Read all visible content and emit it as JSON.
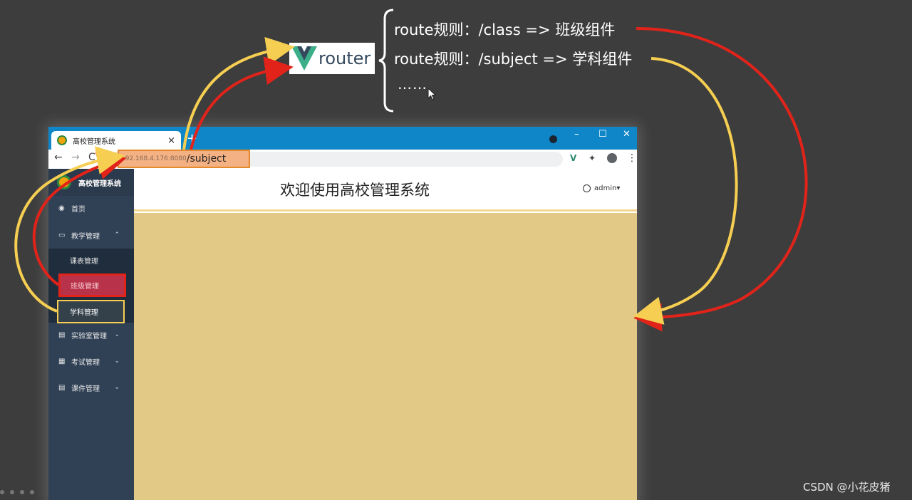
{
  "router": {
    "logo_text": "router",
    "rules": [
      "route规则：/class =>  班级组件",
      "route规则：/subject => 学科组件"
    ],
    "more": "……"
  },
  "browser": {
    "tab_title": "高校管理系统",
    "tab_close": "×",
    "new_tab": "+",
    "window_min": "–",
    "window_max": "☐",
    "window_close": "✕",
    "nav_back": "←",
    "nav_forward": "→",
    "nav_reload": "C",
    "address_host": "192.168.4.176:8080",
    "address_path": "/subject",
    "ext_vue": "V",
    "ext_puzzle": "✦",
    "ext_menu": "⋮"
  },
  "app": {
    "brand_title": "高校管理系统",
    "header_title": "欢迎使用高校管理系统",
    "user_label": "admin▾",
    "menu": {
      "home": "首页",
      "teaching": "教学管理",
      "teaching_arrow": "⌃",
      "sub_schedule": "课表管理",
      "sub_class": "班级管理",
      "sub_subject": "学科管理",
      "lab": "实验室管理",
      "exam": "考试管理",
      "courseware": "课件管理",
      "collapsed_arrow": "⌄"
    }
  },
  "colors": {
    "background": "#3d3d3d",
    "titlebar": "#0f86c8",
    "sidebar": "#304156",
    "content": "#e2ca86",
    "arrow_red": "#e2231a",
    "arrow_yellow": "#f6cf52"
  },
  "icons": {
    "home": "dashboard-icon",
    "teaching": "monitor-icon",
    "lab": "document-icon",
    "exam": "clipboard-icon",
    "courseware": "file-icon"
  },
  "watermark": "CSDN @小花皮猪"
}
